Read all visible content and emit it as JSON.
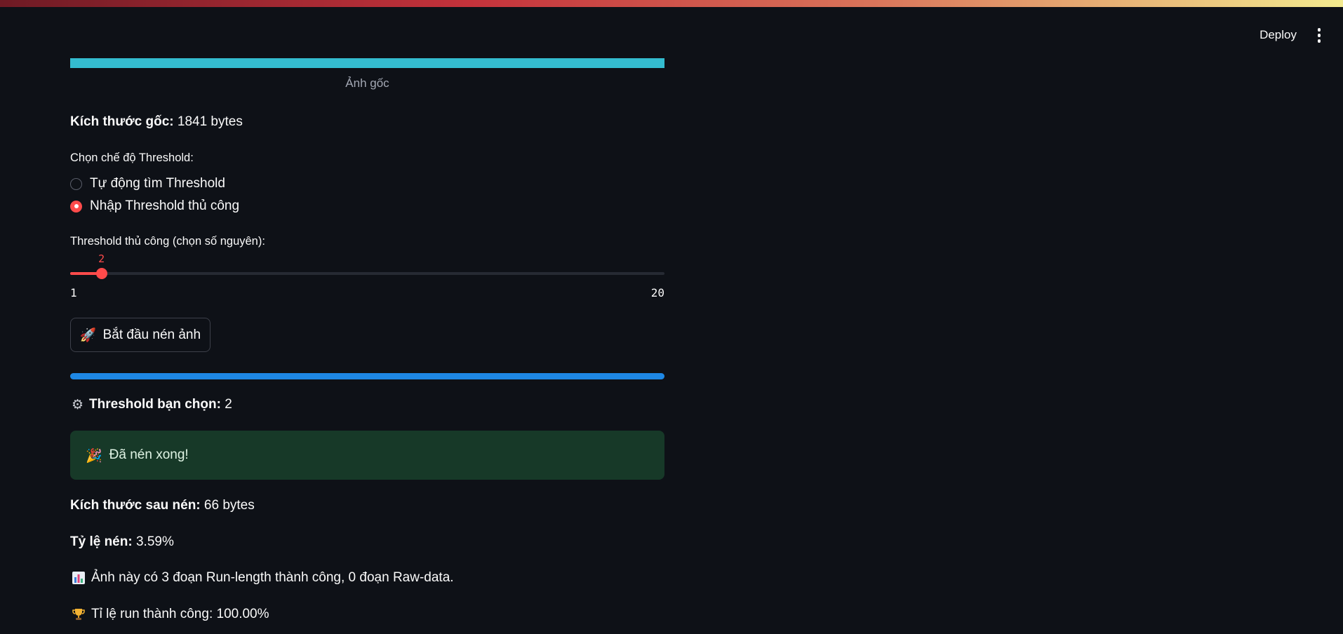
{
  "header": {
    "deploy_label": "Deploy",
    "menu_icon": "vertical-ellipsis-icon"
  },
  "image": {
    "caption": "Ảnh gốc",
    "bar_color": "#34bcd0"
  },
  "original_size": {
    "label": "Kích thước gốc:",
    "value": "1841 bytes"
  },
  "threshold_mode": {
    "label": "Chọn chế độ Threshold:",
    "options": [
      {
        "label": "Tự động tìm Threshold",
        "selected": false
      },
      {
        "label": "Nhập Threshold thủ công",
        "selected": true
      }
    ]
  },
  "slider": {
    "label": "Threshold thủ công (chọn số nguyên):",
    "value": 2,
    "value_text": "2",
    "min": 1,
    "max": 20,
    "min_text": "1",
    "max_text": "20"
  },
  "start_button": {
    "icon": "rocket-icon",
    "label": "Bắt đầu nén ảnh"
  },
  "progress": {
    "value": 1.0,
    "color": "#1e88e5"
  },
  "threshold_chosen": {
    "icon": "gear-icon",
    "label": "Threshold bạn chọn:",
    "value": "2"
  },
  "success": {
    "icon": "party-popper-icon",
    "message": "Đã nén xong!"
  },
  "compressed_size": {
    "label": "Kích thước sau nén:",
    "value": "66 bytes"
  },
  "compression_ratio": {
    "label": "Tỷ lệ nén:",
    "value": "3.59%"
  },
  "runs_info": {
    "icon": "bar-chart-icon",
    "text": "Ảnh này có 3 đoạn Run-length thành công, 0 đoạn Raw-data."
  },
  "success_rate": {
    "icon": "trophy-icon",
    "text": "Tỉ lệ run thành công: 100.00%"
  },
  "colors": {
    "background": "#0e1117",
    "accent": "#ff4b4b",
    "success_bg": "#173928"
  }
}
